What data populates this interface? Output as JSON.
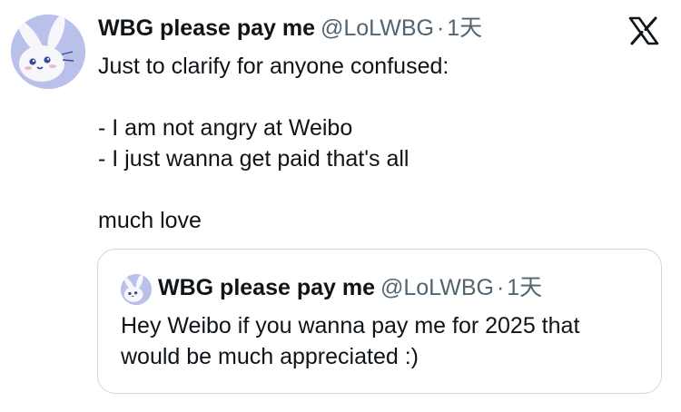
{
  "tweet": {
    "display_name": "WBG please pay me",
    "handle": "@LoLWBG",
    "separator": "·",
    "time": "1天",
    "logo_icon": "x-logo-icon",
    "avatar_icon": "bunny-avatar",
    "lines": [
      "Just to clarify for anyone confused:",
      "",
      "- I am not angry at Weibo",
      "- I just wanna get paid that's all",
      "",
      "much love"
    ]
  },
  "quote": {
    "display_name": "WBG please pay me",
    "handle": "@LoLWBG",
    "separator": "·",
    "time": "1天",
    "avatar_icon": "bunny-avatar",
    "lines": [
      "Hey Weibo if you wanna pay me for 2025 that",
      "would be much appreciated :)"
    ]
  },
  "colors": {
    "text": "#0f1419",
    "secondary": "#536471",
    "border": "#cfd9de",
    "avatar_bg": "#b9c0ea"
  }
}
